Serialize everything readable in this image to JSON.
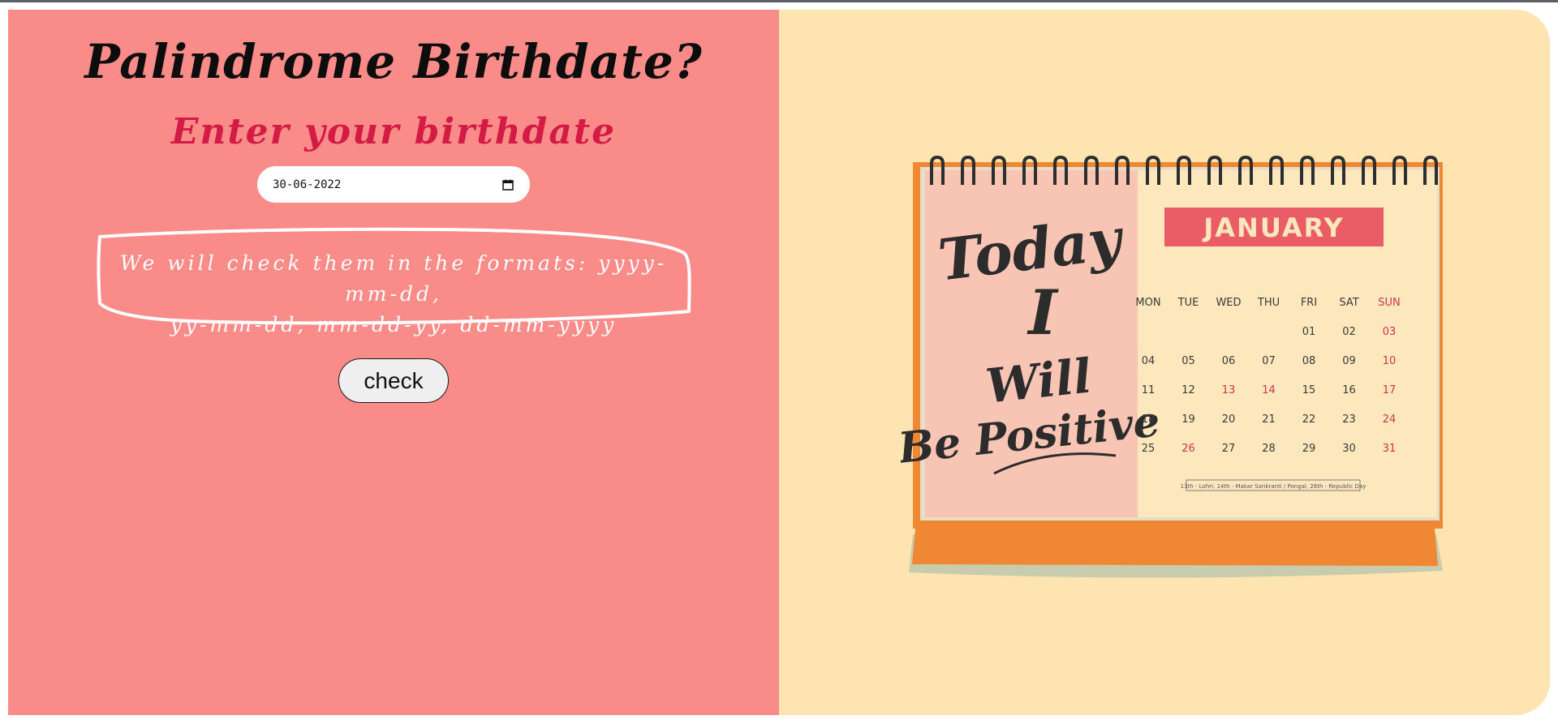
{
  "header": {
    "title": "Palindrome Birthdate?",
    "subtitle": "Enter your birthdate"
  },
  "form": {
    "date_value": "30-06-2022",
    "date_icon": "calendar-icon",
    "notice_line1": "We will check them in the formats: yyyy-mm-dd,",
    "notice_line2": "yy-mm-dd, mm-dd-yy, dd-mm-yyyy",
    "check_label": "check"
  },
  "calendar": {
    "slogan_line1": "Today",
    "slogan_line2": "I",
    "slogan_line3": "Will",
    "slogan_line4": "Be Positive",
    "month": "JANUARY",
    "weekdays": [
      "MON",
      "TUE",
      "WED",
      "THU",
      "FRI",
      "SAT",
      "SUN"
    ],
    "rows": [
      [
        "",
        "",
        "",
        "",
        "01",
        "02",
        "03"
      ],
      [
        "04",
        "05",
        "06",
        "07",
        "08",
        "09",
        "10"
      ],
      [
        "11",
        "12",
        "13",
        "14",
        "15",
        "16",
        "17"
      ],
      [
        "18",
        "19",
        "20",
        "21",
        "22",
        "23",
        "24"
      ],
      [
        "25",
        "26",
        "27",
        "28",
        "29",
        "30",
        "31"
      ]
    ],
    "holidays": [
      "13",
      "14",
      "26"
    ],
    "footnote": "13th - Lohri, 14th - Makar Sankranti / Pongal, 26th - Republic Day"
  },
  "colors": {
    "left_bg": "#f98b89",
    "right_bg": "#fee4b1",
    "title": "#0d0d0d",
    "subtitle": "#d41b45",
    "month_banner": "#ea5d66",
    "calendar_base": "#f08733",
    "holiday": "#d0324f"
  }
}
